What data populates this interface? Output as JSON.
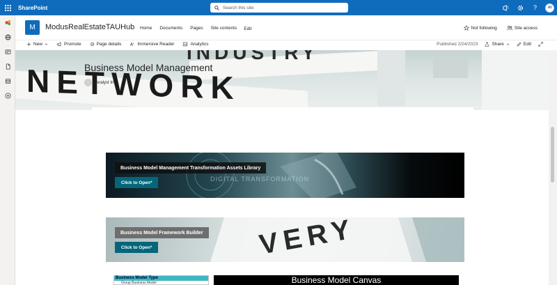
{
  "suite": {
    "brand": "SharePoint",
    "search_placeholder": "Search this site",
    "user_initials": "AI"
  },
  "site": {
    "logo_letter": "M",
    "name": "ModusRealEstateTAUHub",
    "nav": [
      "Home",
      "Documents",
      "Pages",
      "Site contents",
      "Edit"
    ],
    "not_following": "Not following",
    "site_access": "Site access"
  },
  "commands": {
    "new": "New",
    "promote": "Promote",
    "page_details": "Page details",
    "immersive_reader": "Immersive Reader",
    "analytics": "Analytics",
    "published": "Published 2/24/2023",
    "share": "Share",
    "edit": "Edit"
  },
  "banner": {
    "word_main": "NETWORK",
    "word_top": "INDUSTRY"
  },
  "page": {
    "title": "Business Model Management",
    "author": "Analyst In"
  },
  "cards": [
    {
      "label": "Business Model Management Transformation Assets Library",
      "button": "Click to Open*",
      "bg_text": "DIGITAL TRANSFORMATION"
    },
    {
      "label": "Business Model Framework Builder",
      "button": "Click to Open*",
      "bg_text": "VERY"
    }
  ],
  "bottom": {
    "type_header": "Business Model Type",
    "type_row": "Group Business Model",
    "canvas_title": "Business Model Canvas"
  },
  "colors": {
    "suite": "#0f6cbd",
    "button": "#05667a",
    "table_header": "#3fb7c3"
  }
}
